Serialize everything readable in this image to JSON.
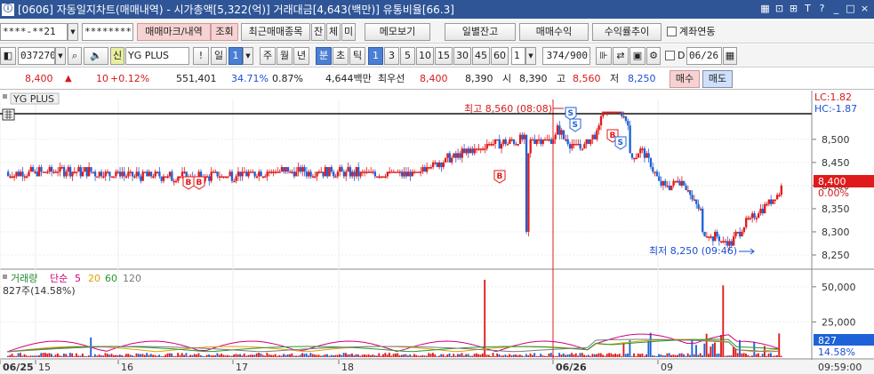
{
  "window": {
    "code": "[0606]",
    "title": "자동일지차트(매매내역) - 시가총액[5,322(억)] 거래대금[4,643(백만)] 유통비율[66.3]",
    "controls": [
      "▦",
      "⊡",
      "⊞",
      "T",
      "?",
      "_",
      "□",
      "×"
    ]
  },
  "toolbar1": {
    "account": "****-**21",
    "password": "********",
    "trade_mark_label": "매매마크/내역",
    "inquiry_label": "조회",
    "recent_label": "최근매매종목",
    "balance_label": "잔",
    "execution_label": "체",
    "pending_label": "미",
    "memo_label": "메모보기",
    "daily_balance_label": "일별잔고",
    "trade_profit_label": "매매수익",
    "profit_trend_label": "수익률추이",
    "account_link_label": "계좌연동"
  },
  "toolbar2": {
    "stock_code": "037270",
    "market_badge": "신",
    "stock_name": "YG PLUS",
    "alert_label": "!",
    "period_day": "일",
    "period_value": "1",
    "periods": [
      "주",
      "월",
      "년"
    ],
    "minute_label": "분",
    "second_label": "초",
    "tick_label": "틱",
    "intervals": [
      "1",
      "3",
      "5",
      "10",
      "15",
      "30",
      "45",
      "60"
    ],
    "active_interval": "1",
    "unit_value": "1",
    "data_count": "374",
    "data_total": "/900",
    "date_checkbox_label": "D",
    "date_value": "06/26"
  },
  "quote": {
    "price": "8,400",
    "change_arrow": "▲",
    "change": "10",
    "change_pct": "+0.12%",
    "volume": "551,401",
    "ratio1": "34.71%",
    "ratio2": "0.87%",
    "amount": "4,644백만",
    "priority_label": "최우선",
    "best_ask": "8,400",
    "best_bid": "8,390",
    "open_label": "시",
    "open": "8,390",
    "high_label": "고",
    "high": "8,560",
    "low_label": "저",
    "low": "8,250",
    "buy_label": "매수",
    "sell_label": "매도"
  },
  "price_panel": {
    "legend": "YG PLUS",
    "lc_label": "LC:1.82",
    "hc_label": "HC:-1.87",
    "high_annotation": "최고 8,560 (08:08)",
    "low_annotation": "최저 8,250 (09:46)",
    "current_price": "8,400",
    "current_pct": "0.00%",
    "y_ticks": [
      "8,500",
      "8,450",
      "8,400",
      "8,350",
      "8,300",
      "8,250"
    ]
  },
  "volume_panel": {
    "legend_title": "거래량",
    "legend_ma_label": "단순",
    "legend_ma": [
      "5",
      "20",
      "60",
      "120"
    ],
    "legend_ma_colors": [
      "#d2007d",
      "#e0a000",
      "#1f9a2e",
      "#7a7a7a"
    ],
    "sub_label": "827주(14.58%)",
    "y_ticks": [
      "50,000",
      "25,000"
    ],
    "current_volume": "827",
    "current_pct": "14.58%"
  },
  "time_axis": {
    "labels": [
      "06/25",
      "15",
      "16",
      "17",
      "18",
      "06/26",
      "09"
    ],
    "current_time": "09:59:00"
  },
  "colors": {
    "up": "#e01a1a",
    "down": "#1d62d8",
    "title_bar": "#2f5597",
    "accent_blue": "#2f62d0"
  },
  "chart_data": {
    "type": "candlestick",
    "panels": [
      "price",
      "volume"
    ],
    "price_range": [
      8225,
      8590
    ],
    "high": {
      "value": 8560,
      "time": "08:08"
    },
    "low": {
      "value": 8250,
      "time": "09:46"
    },
    "last": 8400,
    "volume_range": [
      0,
      60000
    ]
  }
}
